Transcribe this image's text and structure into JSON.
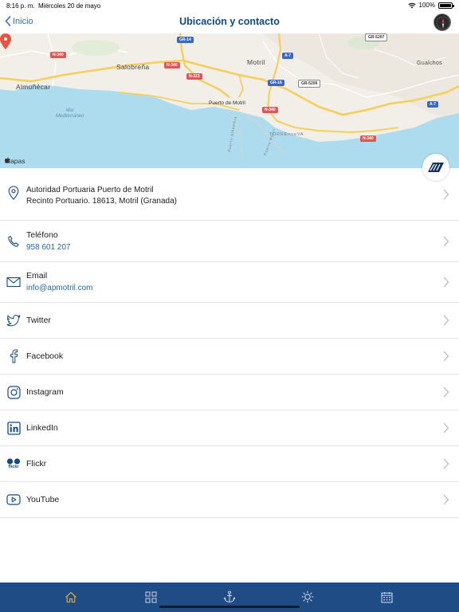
{
  "status": {
    "time": "8:16 p. m.",
    "date": "Miércoles 20 de mayo",
    "battery": "100%"
  },
  "nav": {
    "back_label": "Inicio",
    "title": "Ubicación y contacto"
  },
  "map": {
    "towns": [
      "Salobreña",
      "Motril",
      "Almuñécar",
      "Gualchos"
    ],
    "sea_label": "Mar\nMediterráneo",
    "pin_label": "Puerto de Motril",
    "small_labels": [
      "TORREnueVA",
      "Puerto Alhambra",
      "Puerto Motril"
    ],
    "road_badges": [
      "GR-14",
      "GR-5207",
      "N-340",
      "N-340",
      "N-323",
      "A-7",
      "GR-16",
      "GR-5209",
      "N-340",
      "A-7",
      "N-340"
    ],
    "attribution": "Mapas"
  },
  "contacts": [
    {
      "id": "address",
      "icon": "location-pin-icon",
      "title": "Autoridad Portuaria Puerto de Motril",
      "sub": "Recinto Portuario. 18613, Motril (Granada)"
    },
    {
      "id": "phone",
      "icon": "phone-icon",
      "title": "Teléfono",
      "sub": "958 601 207"
    },
    {
      "id": "email",
      "icon": "envelope-icon",
      "title": "Email",
      "sub": "info@apmotril.com"
    },
    {
      "id": "twitter",
      "icon": "twitter-icon",
      "title": "Twitter"
    },
    {
      "id": "facebook",
      "icon": "facebook-icon",
      "title": "Facebook"
    },
    {
      "id": "instagram",
      "icon": "instagram-icon",
      "title": "Instagram"
    },
    {
      "id": "linkedin",
      "icon": "linkedin-icon",
      "title": "LinkedIn"
    },
    {
      "id": "flickr",
      "icon": "flickr-icon",
      "title": "Flickr",
      "icon_text": "flickr"
    },
    {
      "id": "youtube",
      "icon": "youtube-icon",
      "title": "YouTube"
    }
  ],
  "tabs": [
    {
      "id": "home",
      "icon": "home-icon",
      "active": true
    },
    {
      "id": "grid",
      "icon": "grid-icon",
      "active": false
    },
    {
      "id": "port",
      "icon": "anchor-icon",
      "active": false
    },
    {
      "id": "weather",
      "icon": "sun-icon",
      "active": false
    },
    {
      "id": "calendar",
      "icon": "calendar-icon",
      "active": false
    }
  ],
  "colors": {
    "accent": "#2f6fc4",
    "title": "#0f4a86",
    "link": "#2866a8",
    "tab_bar": "#1f4c85",
    "tab_active": "#d9a441",
    "tab_inactive": "#c8d3e3",
    "sea": "#aedcef",
    "pin": "#e8533f"
  }
}
